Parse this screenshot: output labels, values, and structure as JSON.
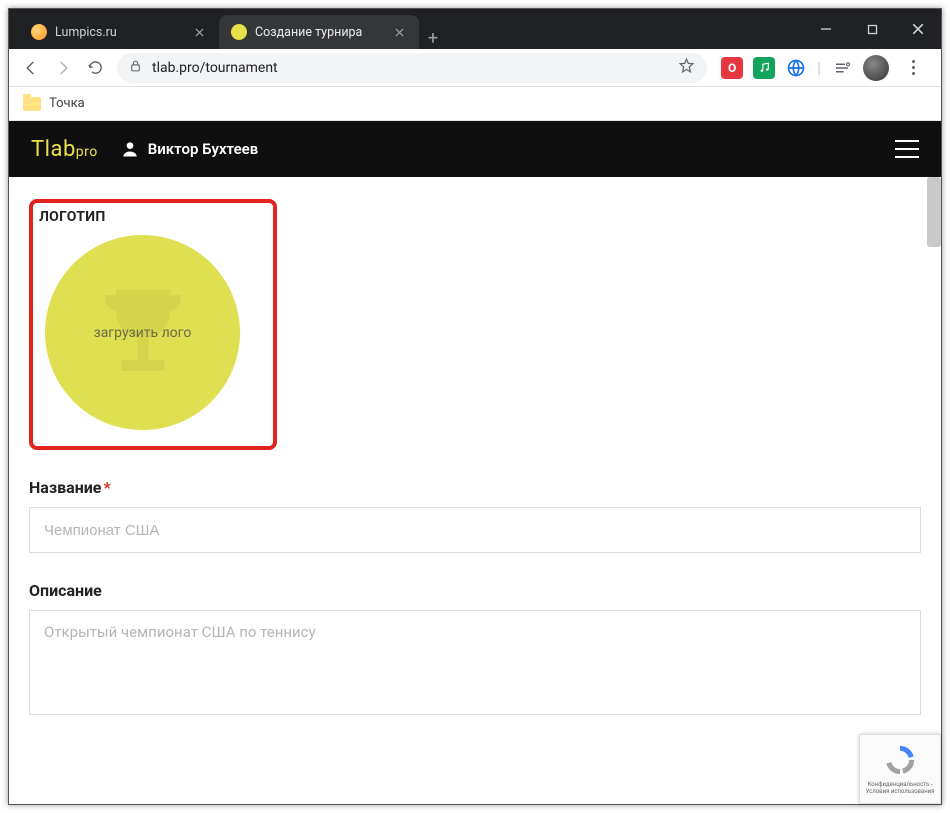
{
  "browser": {
    "tabs": [
      {
        "title": "Lumpics.ru",
        "active": false
      },
      {
        "title": "Создание турнира",
        "active": true
      }
    ],
    "url": "tlab.pro/tournament"
  },
  "bookmarks": {
    "item1": "Точка"
  },
  "site": {
    "logo_main": "Tlab",
    "logo_sub": "pro",
    "user_name": "Виктор Бухтеев"
  },
  "form": {
    "logo_section_label": "ЛОГОТИП",
    "logo_upload_text": "загрузить лого",
    "name": {
      "label": "Название",
      "required_mark": "*",
      "placeholder": "Чемпионат США"
    },
    "description": {
      "label": "Описание",
      "placeholder": "Открытый чемпионат США по теннису"
    }
  },
  "recaptcha": {
    "line1": "Конфиденциальность -",
    "line2": "Условия использования"
  }
}
